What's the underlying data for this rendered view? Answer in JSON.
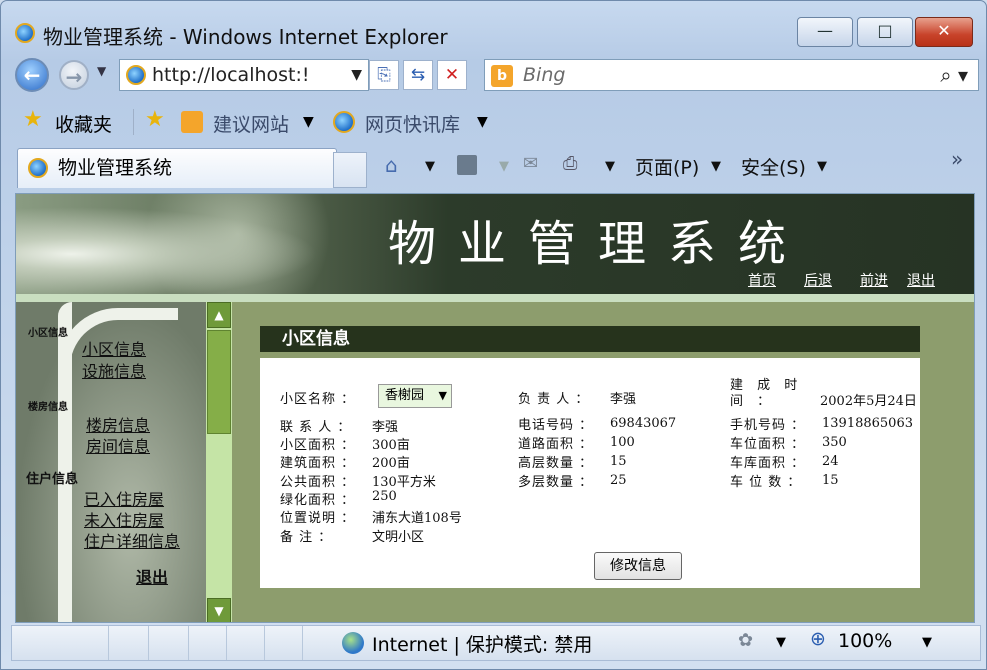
{
  "window": {
    "title": "物业管理系统 - Windows Internet Explorer",
    "minimize": "—",
    "maximize": "□",
    "close": "✕"
  },
  "browser": {
    "address": "http://localhost:!",
    "search_placeholder": "Bing",
    "favorites_label": "收藏夹",
    "suggested_sites": "建议网站",
    "web_slice_gallery": "网页快讯库",
    "tab_title": "物业管理系统",
    "page_menu": "页面(P)",
    "safety_menu": "安全(S)",
    "chevron": "»"
  },
  "header": {
    "title": "物业管理系统",
    "nav": [
      "首页",
      "后退",
      "前进",
      "退出"
    ]
  },
  "sidebar": {
    "sections": [
      {
        "title": "小区信息",
        "items": [
          "小区信息",
          "设施信息"
        ]
      },
      {
        "title": "楼房信息",
        "items": [
          "楼房信息",
          "房间信息"
        ]
      },
      {
        "title": "住户信息",
        "items": [
          "已入住房屋",
          "未入住房屋",
          "住户详细信息"
        ]
      }
    ],
    "exit": "退出"
  },
  "main": {
    "section_title": "小区信息",
    "fields": {
      "name_label": "小区名称 ：",
      "name_value": "香榭园",
      "manager_label": "负 责 人 ：",
      "manager_value": "李强",
      "build_time_label": "建 成 时 间 ：",
      "build_time_value": "2002年5月24日",
      "contact_label": "联 系 人 ：",
      "contact_value": "李强",
      "phone_label": "电话号码 ：",
      "phone_value": "69843067",
      "mobile_label": "手机号码 ：",
      "mobile_value": "13918865063",
      "area_label": "小区面积 ：",
      "area_value": "300亩",
      "road_label": "道路面积 ：",
      "road_value": "100",
      "parking_area_label": "车位面积 ：",
      "parking_area_value": "350",
      "build_area_label": "建筑面积 ：",
      "build_area_value": "200亩",
      "high_label": "高层数量 ：",
      "high_value": "15",
      "garage_label": "车库面积 ：",
      "garage_value": "24",
      "public_label": "公共面积 ：",
      "public_value": "130平方米",
      "multi_label": "多层数量 ：",
      "multi_value": "25",
      "spaces_label": "车 位 数 ：",
      "spaces_value": "15",
      "green_label": "绿化面积 ：",
      "green_value": "250",
      "location_label": "位置说明 ：",
      "location_value": "浦东大道108号",
      "remark_label": "备 注 ：",
      "remark_value": "文明小区"
    },
    "edit_button": "修改信息"
  },
  "status": {
    "zone": "Internet | 保护模式: 禁用",
    "zoom": "100%"
  }
}
